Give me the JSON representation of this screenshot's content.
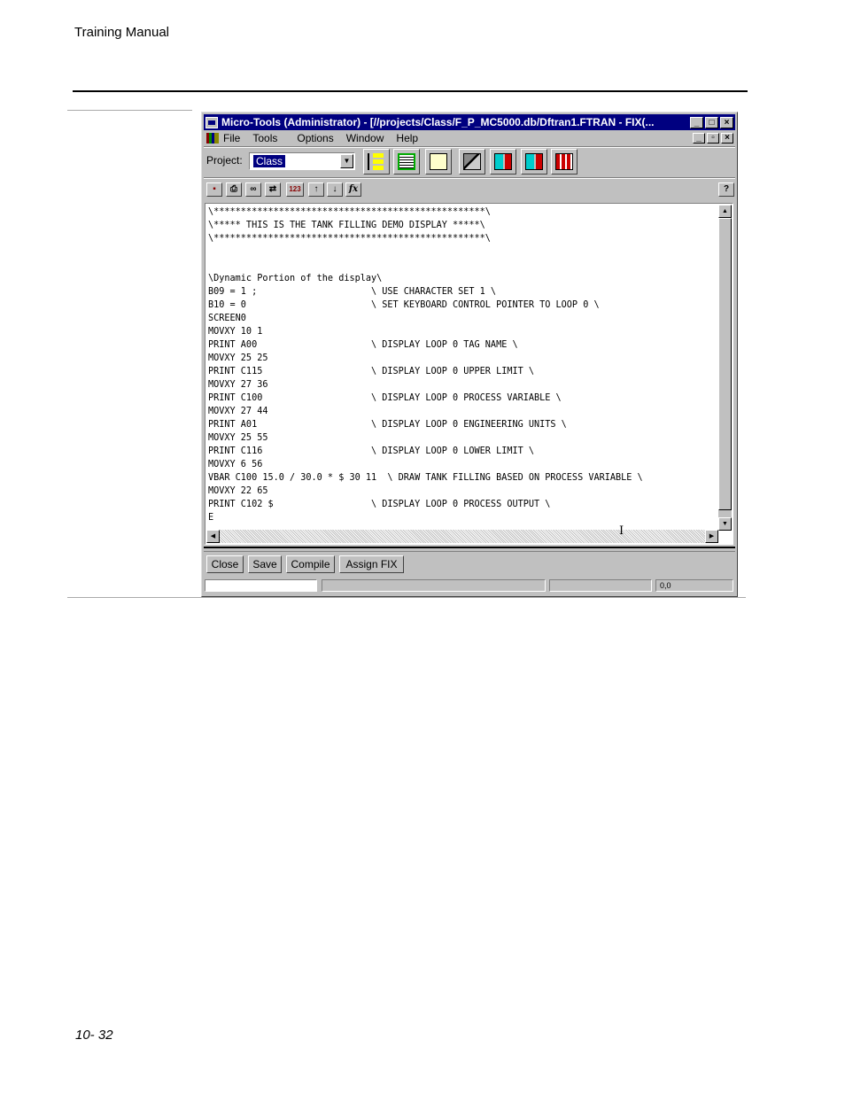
{
  "page": {
    "header": "Training Manual",
    "footer": "10- 32"
  },
  "window": {
    "title": "Micro-Tools (Administrator) - [//projects/Class/F_P_MC5000.db/Dftran1.FTRAN - FIX(...",
    "title_buttons": [
      "_",
      "□",
      "×"
    ],
    "menu": [
      "File",
      "Tools",
      "Options",
      "Window",
      "Help"
    ],
    "mdi_buttons": [
      "_",
      "&#x1F5D7;",
      "×"
    ],
    "project": {
      "label": "Project:",
      "selected": "Class"
    },
    "big_toolbar_icons": [
      "tree-view-icon",
      "list-view-icon",
      "document-view-icon",
      "build-tools-icon",
      "export-icon",
      "import-icon",
      "loop-bars-icon"
    ],
    "small_toolbar": {
      "buttons": [
        "save-icon",
        "print-icon",
        "find-icon",
        "replace-icon",
        "calculator-icon",
        "upload-icon",
        "download-icon",
        "function-icon"
      ],
      "help": "?"
    },
    "code_lines": [
      "\\**************************************************\\",
      "\\***** THIS IS THE TANK FILLING DEMO DISPLAY *****\\",
      "\\**************************************************\\",
      "",
      "",
      "\\Dynamic Portion of the display\\",
      "B09 = 1 ;                     \\ USE CHARACTER SET 1 \\",
      "B10 = 0                       \\ SET KEYBOARD CONTROL POINTER TO LOOP 0 \\",
      "SCREEN0",
      "MOVXY 10 1",
      "PRINT A00                     \\ DISPLAY LOOP 0 TAG NAME \\",
      "MOVXY 25 25",
      "PRINT C115                    \\ DISPLAY LOOP 0 UPPER LIMIT \\",
      "MOVXY 27 36",
      "PRINT C100                    \\ DISPLAY LOOP 0 PROCESS VARIABLE \\",
      "MOVXY 27 44",
      "PRINT A01                     \\ DISPLAY LOOP 0 ENGINEERING UNITS \\",
      "MOVXY 25 55",
      "PRINT C116                    \\ DISPLAY LOOP 0 LOWER LIMIT \\",
      "MOVXY 6 56",
      "VBAR C100 15.0 / 30.0 * $ 30 11  \\ DRAW TANK FILLING BASED ON PROCESS VARIABLE \\",
      "MOVXY 22 65",
      "PRINT C102 $                  \\ DISPLAY LOOP 0 PROCESS OUTPUT \\",
      "E"
    ],
    "buttons": {
      "close": "Close",
      "save": "Save",
      "compile": "Compile",
      "assign_fix": "Assign FIX"
    },
    "status": {
      "panel1": "",
      "panel2": "",
      "panel3": "",
      "position": "0,0"
    }
  }
}
